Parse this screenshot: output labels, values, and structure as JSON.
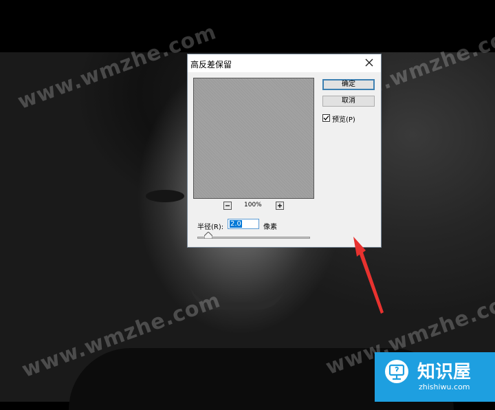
{
  "dialog": {
    "title": "高反差保留",
    "ok_label": "确定",
    "cancel_label": "取消",
    "preview_label": "预览(P)",
    "preview_checked": true,
    "zoom_level": "100%",
    "zoom_out_icon": "minus-icon",
    "zoom_in_icon": "plus-icon",
    "radius_label": "半径(R):",
    "radius_value": "2.0",
    "radius_unit": "像素",
    "radius_slider_fraction": 0.1
  },
  "watermarks": [
    "www.wmzhe.com",
    "www.wmzhe.com",
    "www.wmzhe.com",
    "www.wmzhe.com"
  ],
  "logo": {
    "name": "知识屋",
    "url": "zhishiwu.com"
  },
  "colors": {
    "accent": "#0078d7",
    "arrow": "#e8322f",
    "logo_bg": "#1e9fe0"
  }
}
